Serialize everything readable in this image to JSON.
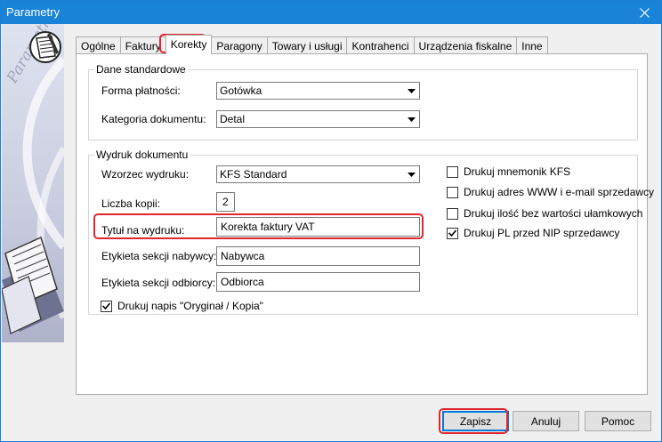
{
  "window": {
    "title": "Parametry"
  },
  "sidebar": {
    "watermark": "Parametry"
  },
  "tabs": [
    "Ogólne",
    "Faktury",
    "Korekty",
    "Paragony",
    "Towary i usługi",
    "Kontrahenci",
    "Urządzenia fiskalne",
    "Inne"
  ],
  "active_tab": "Korekty",
  "standard": {
    "legend": "Dane standardowe",
    "payment_label": "Forma płatności:",
    "payment_value": "Gotówka",
    "category_label": "Kategoria dokumentu:",
    "category_value": "Detal"
  },
  "print": {
    "legend": "Wydruk dokumentu",
    "template_label": "Wzorzec wydruku:",
    "template_value": "KFS Standard",
    "copies_label": "Liczba kopii:",
    "copies_value": "2",
    "title_label": "Tytuł na wydruku:",
    "title_value": "Korekta faktury VAT",
    "buyer_label": "Etykieta sekcji nabywcy:",
    "buyer_value": "Nabywca",
    "recipient_label": "Etykieta sekcji odbiorcy:",
    "recipient_value": "Odbiorca",
    "original_copy_label": "Drukuj napis \"Oryginał / Kopia\"",
    "original_copy_checked": true
  },
  "options": [
    {
      "label": "Drukuj mnemonik KFS",
      "checked": false
    },
    {
      "label": "Drukuj adres WWW i e-mail sprzedawcy",
      "checked": false
    },
    {
      "label": "Drukuj ilość bez wartości ułamkowych",
      "checked": false
    },
    {
      "label": "Drukuj PL przed NIP sprzedawcy",
      "checked": true
    }
  ],
  "buttons": {
    "save": "Zapisz",
    "cancel": "Anuluj",
    "help": "Pomoc"
  },
  "colors": {
    "titlebar": "#1883d7",
    "highlight": "#e0262d",
    "default_button_border": "#0078d7"
  }
}
